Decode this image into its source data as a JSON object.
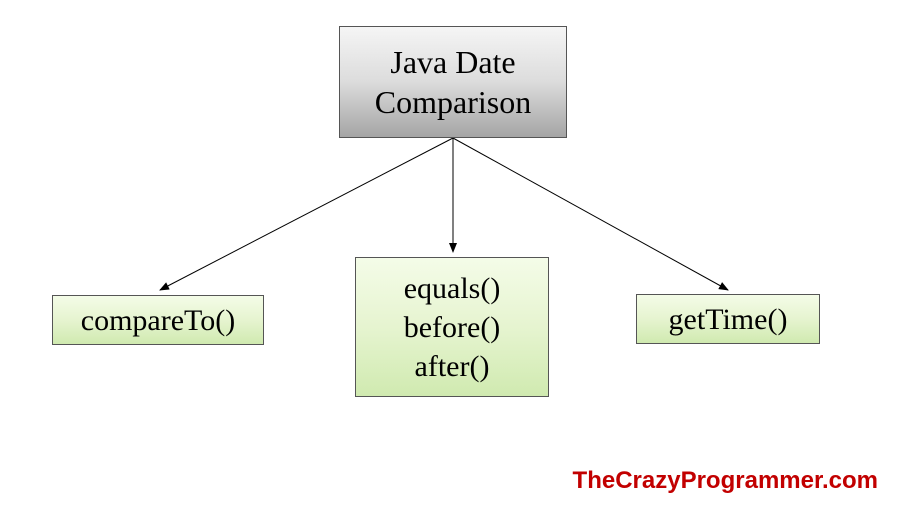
{
  "chart_data": {
    "type": "tree",
    "root": {
      "label": "Java Date\nComparison",
      "children": [
        {
          "label": "compareTo()"
        },
        {
          "label": "equals()\nbefore()\nafter()"
        },
        {
          "label": "getTime()"
        }
      ]
    }
  },
  "root": {
    "line1": "Java Date",
    "line2": "Comparison"
  },
  "children": {
    "left": "compareTo()",
    "mid": {
      "line1": "equals()",
      "line2": "before()",
      "line3": "after()"
    },
    "right": "getTime()"
  },
  "watermark": "TheCrazyProgrammer.com"
}
